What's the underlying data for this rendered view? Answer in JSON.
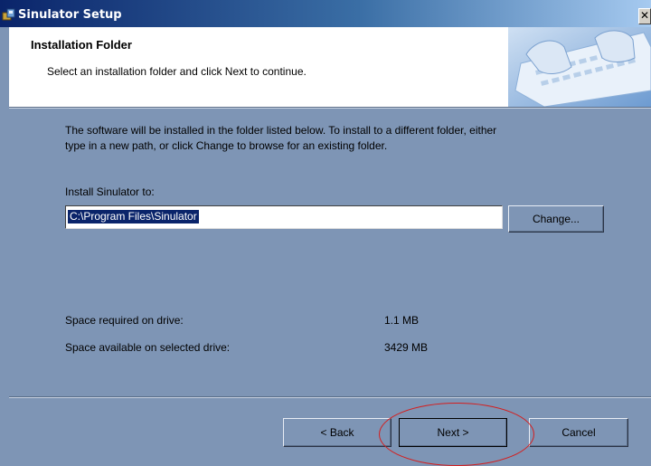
{
  "window": {
    "title": "Sinulator Setup",
    "close_glyph": "✕",
    "app_icon": "setup-icon"
  },
  "header": {
    "title": "Installation Folder",
    "subtitle": "Select an installation folder and click Next to continue.",
    "banner_image": "keyboard-typing-image"
  },
  "body": {
    "description_line1": "The software will be installed in the folder listed below. To install to a different folder, either",
    "description_line2": "type in a new path, or click Change to browse for an existing folder.",
    "install_label": "Install Sinulator to:",
    "install_path": "C:\\Program Files\\Sinulator",
    "change_label": "Change...",
    "space_required_label": "Space required on drive:",
    "space_required_value": "1.1 MB",
    "space_available_label": "Space available on selected drive:",
    "space_available_value": "3429 MB"
  },
  "footer": {
    "back_label": "< Back",
    "next_label": "Next >",
    "cancel_label": "Cancel"
  },
  "colors": {
    "dialog_bg": "#7e95b5",
    "title_gradient_start": "#0a246a",
    "highlight_circle": "#d41e1e"
  }
}
